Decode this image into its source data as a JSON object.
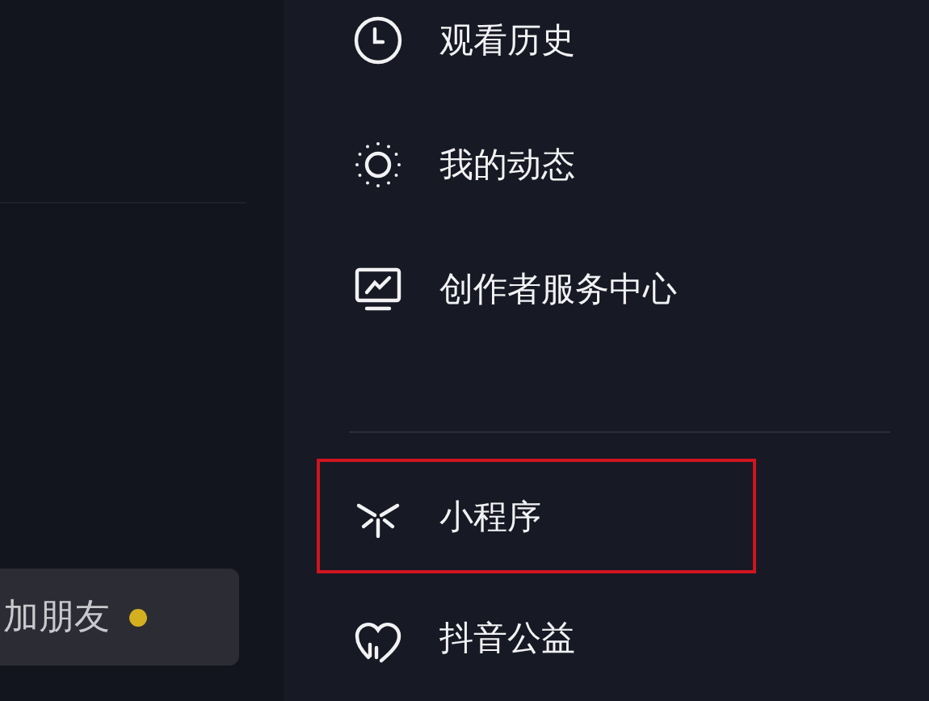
{
  "left_panel": {
    "button": {
      "label": "加朋友",
      "has_dot": true
    }
  },
  "menu": {
    "sections": [
      {
        "items": [
          {
            "kind": "clock",
            "label": "观看历史",
            "highlighted": false
          },
          {
            "kind": "sun",
            "label": "我的动态",
            "highlighted": false
          },
          {
            "kind": "monitor",
            "label": "创作者服务中心",
            "highlighted": false
          }
        ]
      },
      {
        "items": [
          {
            "kind": "spark",
            "label": "小程序",
            "highlighted": true
          },
          {
            "kind": "heart",
            "label": "抖音公益",
            "highlighted": false
          }
        ]
      }
    ]
  }
}
